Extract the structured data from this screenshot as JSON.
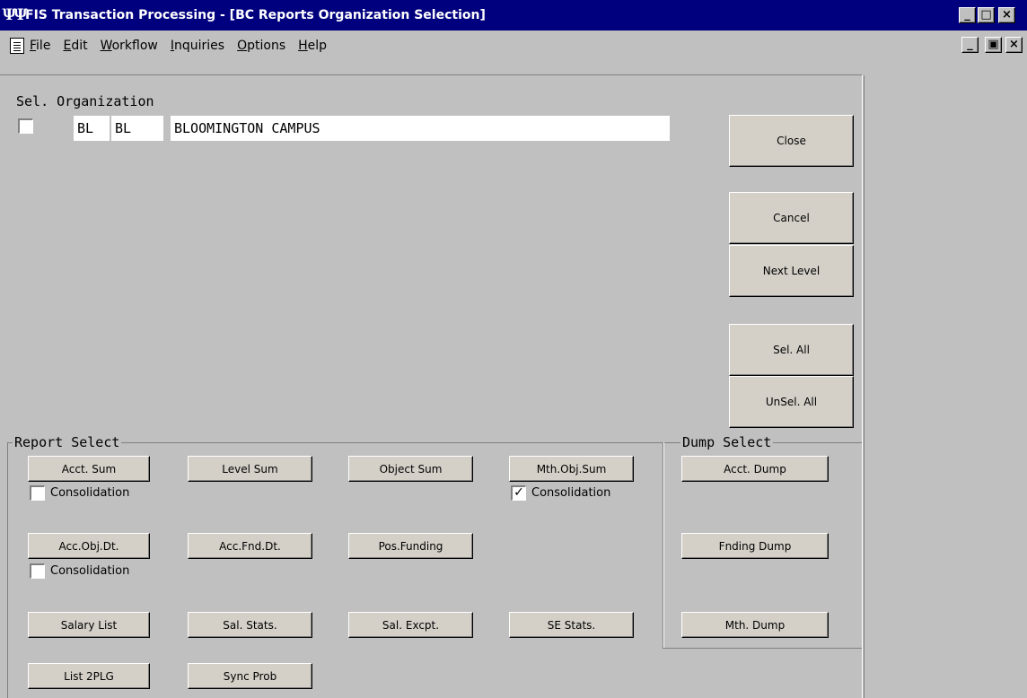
{
  "window": {
    "app_icon": "ΨΨ",
    "title": "FIS Transaction Processing - [BC Reports Organization Selection]",
    "controls": {
      "minimize": "_",
      "maximize": "□",
      "close": "×"
    },
    "mdi_controls": {
      "minimize": "_",
      "restore": "▣",
      "close": "×"
    }
  },
  "menu": {
    "items": [
      {
        "first": "F",
        "rest": "ile"
      },
      {
        "first": "E",
        "rest": "dit"
      },
      {
        "first": "W",
        "rest": "orkflow"
      },
      {
        "first": "I",
        "rest": "nquiries"
      },
      {
        "first": "O",
        "rest": "ptions"
      },
      {
        "first": "H",
        "rest": "elp"
      }
    ]
  },
  "organization": {
    "header": "Sel. Organization",
    "rows": [
      {
        "selected": false,
        "chart": "BL",
        "org": "BL",
        "name": "BLOOMINGTON CAMPUS"
      }
    ]
  },
  "actions": {
    "close": "Close",
    "cancel": "Cancel",
    "next_level": "Next Level",
    "sel_all": "Sel. All",
    "unsel_all": "UnSel. All"
  },
  "report_select": {
    "label": "Report Select",
    "buttons": {
      "acct_sum": "Acct. Sum",
      "level_sum": "Level Sum",
      "object_sum": "Object Sum",
      "mth_obj_sum": "Mth.Obj.Sum",
      "acc_obj_dt": "Acc.Obj.Dt.",
      "acc_fnd_dt": "Acc.Fnd.Dt.",
      "pos_funding": "Pos.Funding",
      "salary_list": "Salary List",
      "sal_stats": "Sal. Stats.",
      "sal_excpt": "Sal. Excpt.",
      "se_stats": "SE Stats.",
      "list_2plg": "List 2PLG",
      "sync_prob": "Sync Prob"
    },
    "consolidation": {
      "label": "Consolidation",
      "acct_sum_checked": false,
      "mth_obj_sum_checked": true,
      "acc_obj_dt_checked": false,
      "check_mark": "✓"
    }
  },
  "dump_select": {
    "label": "Dump Select",
    "buttons": {
      "acct_dump": "Acct. Dump",
      "fnding_dump": "Fnding Dump",
      "mth_dump": "Mth. Dump"
    }
  }
}
